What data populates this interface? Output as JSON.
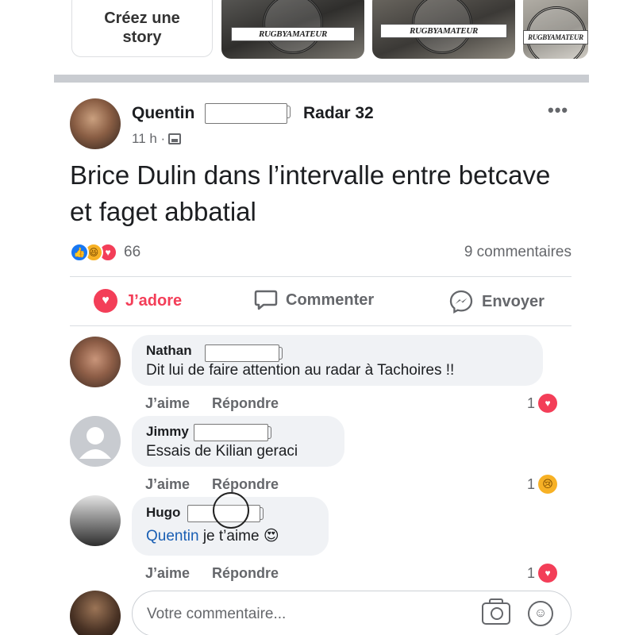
{
  "stories": {
    "create_label": "Créez une\nstory",
    "watermark": "RUGBYAMATEUR"
  },
  "post": {
    "author": "Quentin",
    "group": "Radar 32",
    "time": "11 h ·",
    "text": "Brice Dulin dans l’intervalle entre betcave et faget abbatial",
    "reaction_count": "66",
    "comments_count": "9 commentaires",
    "actions": {
      "love": "J’adore",
      "comment": "Commenter",
      "send": "Envoyer"
    }
  },
  "comments": [
    {
      "name": "Nathan",
      "text": "Dit lui de faire attention au radar à Tachoires !!",
      "like": "J’aime",
      "reply": "Répondre",
      "reaction_count": "1",
      "reaction": "love"
    },
    {
      "name": "Jimmy",
      "text": "Essais de Kilian geraci",
      "like": "J’aime",
      "reply": "Répondre",
      "reaction_count": "1",
      "reaction": "sad"
    },
    {
      "name": "Hugo",
      "mention": "Quentin",
      "text": "je t’aime 😍",
      "like": "J’aime",
      "reply": "Répondre",
      "reaction_count": "1",
      "reaction": "love"
    }
  ],
  "composer": {
    "placeholder": "Votre commentaire..."
  },
  "colors": {
    "love": "#f33e58",
    "like": "#1877f2",
    "mention": "#1a5fb4",
    "muted": "#65676b"
  }
}
